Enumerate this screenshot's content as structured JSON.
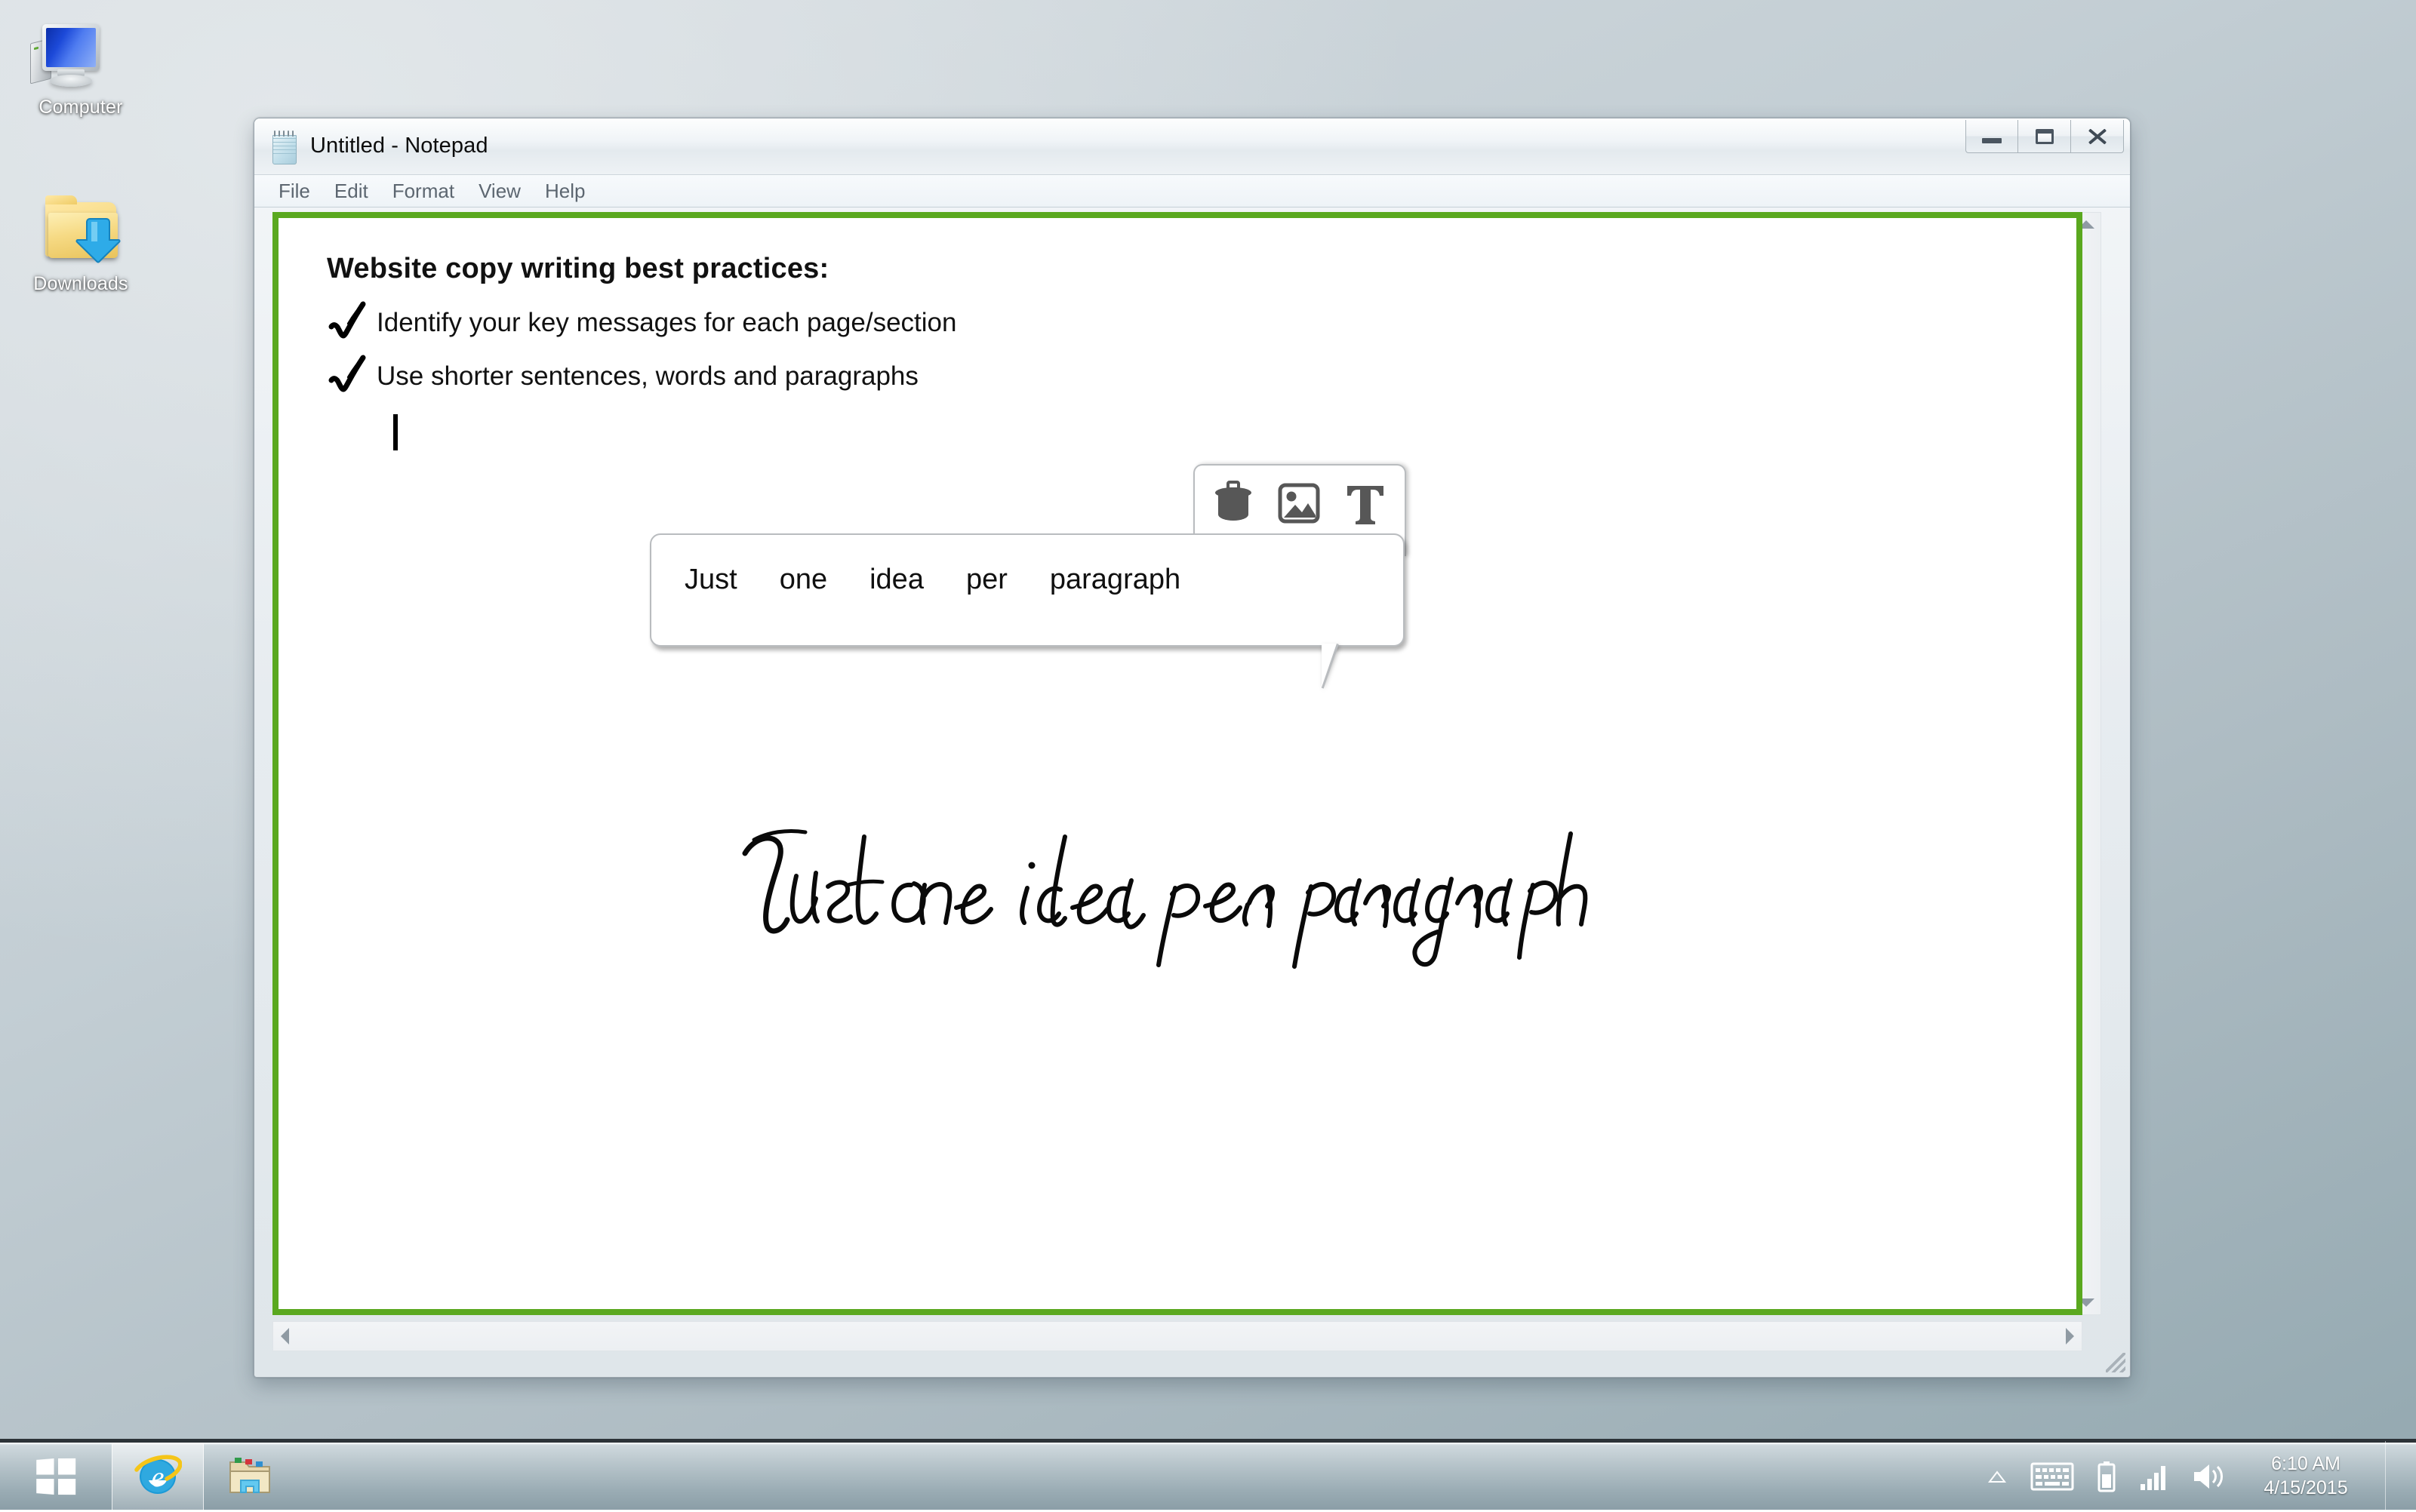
{
  "desktop": {
    "icons": [
      {
        "label": "Computer",
        "icon": "computer-icon"
      },
      {
        "label": "Downloads",
        "icon": "downloads-folder-icon"
      }
    ]
  },
  "window": {
    "title": "Untitled - Notepad",
    "icon": "notepad-icon",
    "controls": {
      "minimize": "Minimize",
      "maximize": "Maximize",
      "close": "Close"
    },
    "menu": [
      "File",
      "Edit",
      "Format",
      "View",
      "Help"
    ],
    "accent_border_color": "#5aa81f"
  },
  "note": {
    "heading": "Website copy writing best practices:",
    "bullets": [
      {
        "mark": "checkmark-icon",
        "text": "Identify your key messages for each page/section"
      },
      {
        "mark": "checkmark-icon",
        "text": "Use shorter sentences, words and paragraphs"
      }
    ],
    "caret": "text-caret"
  },
  "ink_callout": {
    "recognized_words": [
      "Just",
      "one",
      "idea",
      "per",
      "paragraph"
    ],
    "tools": [
      {
        "name": "delete-icon",
        "label": "Delete"
      },
      {
        "name": "image-icon",
        "label": "Insert image"
      },
      {
        "name": "text-icon",
        "label": "Convert to text"
      }
    ],
    "handwriting_text": "Just one idea per paragraph"
  },
  "scrollbars": {
    "vertical": {
      "up": "scroll-up",
      "down": "scroll-down"
    },
    "horizontal": {
      "left": "scroll-left",
      "right": "scroll-right"
    },
    "resize_grip": "resize-grip"
  },
  "taskbar": {
    "start": "Start",
    "items": [
      {
        "name": "internet-explorer",
        "active": true
      },
      {
        "name": "file-explorer",
        "active": false
      }
    ],
    "tray": [
      {
        "name": "show-hidden-icons-icon"
      },
      {
        "name": "keyboard-icon"
      },
      {
        "name": "battery-icon"
      },
      {
        "name": "network-signal-icon"
      },
      {
        "name": "volume-icon"
      }
    ],
    "clock": {
      "time": "6:10 AM",
      "date": "4/15/2015"
    }
  }
}
